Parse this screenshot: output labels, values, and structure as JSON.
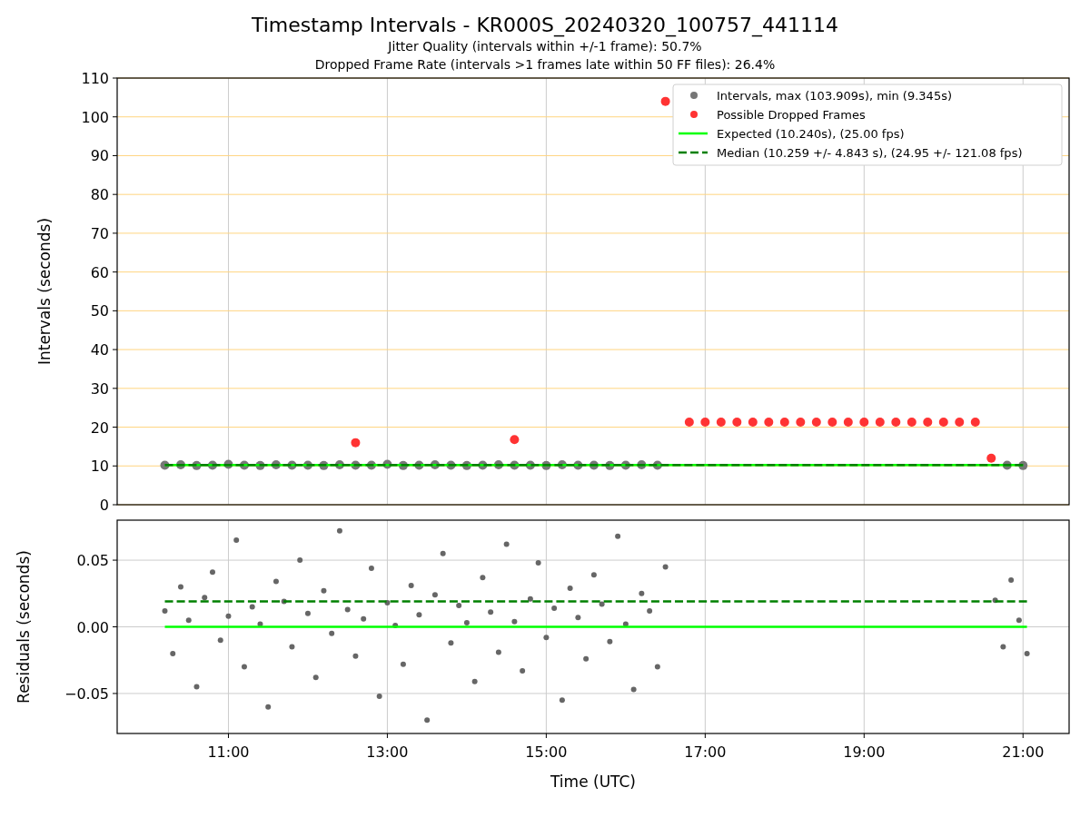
{
  "title": "Timestamp Intervals - KR000S_20240320_100757_441114",
  "subtitles": [
    "Jitter Quality (intervals within +/-1 frame): 50.7%",
    "Dropped Frame Rate (intervals >1 frames late within 50 FF files): 26.4%"
  ],
  "intervals": {
    "chart_data": {
      "type": "scatter",
      "grid": true,
      "legend": "upper right",
      "ylabel": "Intervals (seconds)",
      "xlim": [
        9.6,
        21.58
      ],
      "ylim": [
        0,
        110
      ],
      "yticks": [
        0,
        10,
        20,
        30,
        40,
        50,
        60,
        70,
        80,
        90,
        100,
        110
      ],
      "x": [
        10.2,
        10.4,
        10.6,
        10.8,
        11.0,
        11.2,
        11.4,
        11.6,
        11.8,
        12.0,
        12.2,
        12.4,
        12.6,
        12.8,
        13.0,
        13.2,
        13.4,
        13.6,
        13.8,
        14.0,
        14.2,
        14.4,
        14.6,
        14.8,
        15.0,
        15.2,
        15.4,
        15.6,
        15.8,
        16.0,
        16.2,
        16.4,
        16.5,
        16.8,
        17.0,
        17.2,
        17.4,
        17.6,
        17.8,
        18.0,
        18.2,
        18.4,
        18.6,
        18.8,
        19.0,
        19.2,
        19.4,
        19.6,
        19.8,
        20.0,
        20.2,
        20.4,
        20.6,
        20.8,
        21.0
      ],
      "series": [
        {
          "name": "Intervals, max (103.909s), min (9.345s)",
          "type": "scatter",
          "color": "#777777",
          "values": [
            10.2,
            10.3,
            10.1,
            10.2,
            10.4,
            10.2,
            10.1,
            10.3,
            10.2,
            10.2,
            10.1,
            10.3,
            10.2,
            10.2,
            10.4,
            10.1,
            10.2,
            10.3,
            10.2,
            10.1,
            10.2,
            10.3,
            10.2,
            10.2,
            10.1,
            10.3,
            10.2,
            10.2,
            10.1,
            10.2,
            10.3,
            10.2,
            null,
            null,
            null,
            null,
            null,
            null,
            null,
            null,
            null,
            null,
            null,
            null,
            null,
            null,
            null,
            null,
            null,
            null,
            null,
            null,
            null,
            10.2,
            10.1
          ]
        },
        {
          "name": "Possible Dropped Frames",
          "type": "scatter",
          "color": "#ff3333",
          "values": [
            null,
            null,
            null,
            null,
            null,
            null,
            null,
            null,
            null,
            null,
            null,
            null,
            16,
            null,
            null,
            null,
            null,
            null,
            null,
            null,
            null,
            null,
            16.8,
            null,
            null,
            null,
            null,
            null,
            null,
            null,
            null,
            null,
            104,
            21.3,
            21.3,
            21.3,
            21.3,
            21.3,
            21.3,
            21.3,
            21.3,
            21.3,
            21.3,
            21.3,
            21.3,
            21.3,
            21.3,
            21.3,
            21.3,
            21.3,
            21.3,
            21.3,
            12,
            null,
            null
          ]
        },
        {
          "name": "Expected (10.240s), (25.00 fps)",
          "type": "line",
          "color": "#00ff00",
          "values": [
            10.24,
            10.24,
            10.24,
            10.24,
            10.24,
            10.24,
            10.24,
            10.24,
            10.24,
            10.24,
            10.24,
            10.24,
            10.24,
            10.24,
            10.24,
            10.24,
            10.24,
            10.24,
            10.24,
            10.24,
            10.24,
            10.24,
            10.24,
            10.24,
            10.24,
            10.24,
            10.24,
            10.24,
            10.24,
            10.24,
            10.24,
            10.24,
            10.24,
            10.24,
            10.24,
            10.24,
            10.24,
            10.24,
            10.24,
            10.24,
            10.24,
            10.24,
            10.24,
            10.24,
            10.24,
            10.24,
            10.24,
            10.24,
            10.24,
            10.24,
            10.24,
            10.24,
            10.24,
            10.24,
            10.24
          ]
        },
        {
          "name": "Median (10.259 +/- 4.843 s), (24.95 +/- 121.08 fps)",
          "type": "line",
          "line_style": "dashed",
          "color": "#008000",
          "values": [
            10.259,
            10.259,
            10.259,
            10.259,
            10.259,
            10.259,
            10.259,
            10.259,
            10.259,
            10.259,
            10.259,
            10.259,
            10.259,
            10.259,
            10.259,
            10.259,
            10.259,
            10.259,
            10.259,
            10.259,
            10.259,
            10.259,
            10.259,
            10.259,
            10.259,
            10.259,
            10.259,
            10.259,
            10.259,
            10.259,
            10.259,
            10.259,
            10.259,
            10.259,
            10.259,
            10.259,
            10.259,
            10.259,
            10.259,
            10.259,
            10.259,
            10.259,
            10.259,
            10.259,
            10.259,
            10.259,
            10.259,
            10.259,
            10.259,
            10.259,
            10.259,
            10.259,
            10.259,
            10.259,
            10.259
          ]
        }
      ]
    }
  },
  "residuals": {
    "chart_data": {
      "type": "scatter",
      "grid": true,
      "xlabel": "Time (UTC)",
      "ylabel": "Residuals (seconds)",
      "xlim": [
        9.6,
        21.58
      ],
      "ylim": [
        -0.08,
        0.08
      ],
      "xticks": [
        {
          "value": 11,
          "label": "11:00"
        },
        {
          "value": 13,
          "label": "13:00"
        },
        {
          "value": 15,
          "label": "15:00"
        },
        {
          "value": 17,
          "label": "17:00"
        },
        {
          "value": 19,
          "label": "19:00"
        },
        {
          "value": 21,
          "label": "21:00"
        }
      ],
      "yticks": [
        {
          "value": -0.05,
          "label": "−0.05"
        },
        {
          "value": 0,
          "label": "0.00"
        },
        {
          "value": 0.05,
          "label": "0.05"
        }
      ],
      "x": [
        10.2,
        10.3,
        10.4,
        10.5,
        10.6,
        10.7,
        10.8,
        10.9,
        11.0,
        11.1,
        11.2,
        11.3,
        11.4,
        11.5,
        11.6,
        11.7,
        11.8,
        11.9,
        12.0,
        12.1,
        12.2,
        12.3,
        12.4,
        12.5,
        12.6,
        12.7,
        12.8,
        12.9,
        13.0,
        13.1,
        13.2,
        13.3,
        13.4,
        13.5,
        13.6,
        13.7,
        13.8,
        13.9,
        14.0,
        14.1,
        14.2,
        14.3,
        14.4,
        14.5,
        14.6,
        14.7,
        14.8,
        14.9,
        15.0,
        15.1,
        15.2,
        15.3,
        15.4,
        15.5,
        15.6,
        15.7,
        15.8,
        15.9,
        16.0,
        16.1,
        16.2,
        16.3,
        16.4,
        16.5,
        20.65,
        20.75,
        20.85,
        20.95,
        21.05
      ],
      "series": [
        {
          "type": "scatter",
          "color": "#666666",
          "values": [
            0.012,
            -0.02,
            0.03,
            0.005,
            -0.045,
            0.022,
            0.041,
            -0.01,
            0.008,
            0.065,
            -0.03,
            0.015,
            0.002,
            -0.06,
            0.034,
            0.019,
            -0.015,
            0.05,
            0.01,
            -0.038,
            0.027,
            -0.005,
            0.072,
            0.013,
            -0.022,
            0.006,
            0.044,
            -0.052,
            0.018,
            0.001,
            -0.028,
            0.031,
            0.009,
            -0.07,
            0.024,
            0.055,
            -0.012,
            0.016,
            0.003,
            -0.041,
            0.037,
            0.011,
            -0.019,
            0.062,
            0.004,
            -0.033,
            0.021,
            0.048,
            -0.008,
            0.014,
            -0.055,
            0.029,
            0.007,
            -0.024,
            0.039,
            0.017,
            -0.011,
            0.068,
            0.002,
            -0.047,
            0.025,
            0.012,
            -0.03,
            0.045,
            0.02,
            -0.015,
            0.035,
            0.005,
            -0.02
          ]
        },
        {
          "type": "line",
          "color": "#00ff00",
          "values": [
            0,
            0,
            0,
            0,
            0,
            0,
            0,
            0,
            0,
            0,
            0,
            0,
            0,
            0,
            0,
            0,
            0,
            0,
            0,
            0,
            0,
            0,
            0,
            0,
            0,
            0,
            0,
            0,
            0,
            0,
            0,
            0,
            0,
            0,
            0,
            0,
            0,
            0,
            0,
            0,
            0,
            0,
            0,
            0,
            0,
            0,
            0,
            0,
            0,
            0,
            0,
            0,
            0,
            0,
            0,
            0,
            0,
            0,
            0,
            0,
            0,
            0,
            0,
            0,
            0,
            0,
            0,
            0,
            0
          ]
        },
        {
          "type": "line",
          "line_style": "dashed",
          "color": "#008000",
          "values": [
            0.019,
            0.019,
            0.019,
            0.019,
            0.019,
            0.019,
            0.019,
            0.019,
            0.019,
            0.019,
            0.019,
            0.019,
            0.019,
            0.019,
            0.019,
            0.019,
            0.019,
            0.019,
            0.019,
            0.019,
            0.019,
            0.019,
            0.019,
            0.019,
            0.019,
            0.019,
            0.019,
            0.019,
            0.019,
            0.019,
            0.019,
            0.019,
            0.019,
            0.019,
            0.019,
            0.019,
            0.019,
            0.019,
            0.019,
            0.019,
            0.019,
            0.019,
            0.019,
            0.019,
            0.019,
            0.019,
            0.019,
            0.019,
            0.019,
            0.019,
            0.019,
            0.019,
            0.019,
            0.019,
            0.019,
            0.019,
            0.019,
            0.019,
            0.019,
            0.019,
            0.019,
            0.019,
            0.019,
            0.019,
            0.019,
            0.019,
            0.019,
            0.019,
            0.019
          ]
        }
      ]
    }
  }
}
